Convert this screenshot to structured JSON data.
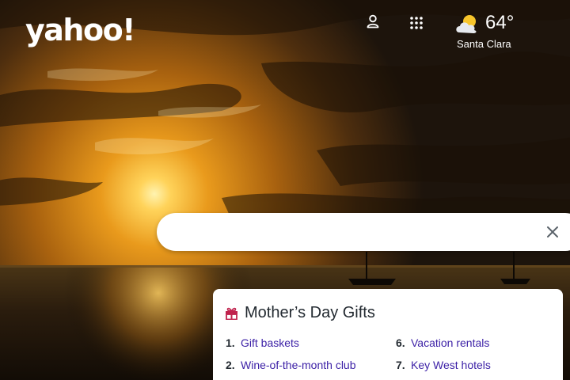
{
  "header": {
    "logo": "yahoo!",
    "account_icon": "user-icon",
    "apps_icon": "grid-icon"
  },
  "weather": {
    "icon": "partly-cloudy-icon",
    "temperature": "64°",
    "location": "Santa Clara"
  },
  "search": {
    "value": "",
    "placeholder": "",
    "clear_icon": "close-icon"
  },
  "trending": {
    "icon": "gift-icon",
    "title": "Mother’s Day Gifts",
    "items": [
      {
        "num": "1.",
        "label": "Gift baskets"
      },
      {
        "num": "2.",
        "label": "Wine-of-the-month club"
      },
      {
        "num": "6.",
        "label": "Vacation rentals"
      },
      {
        "num": "7.",
        "label": "Key West hotels"
      }
    ]
  },
  "colors": {
    "link": "#3b1fa6",
    "text": "#232a31",
    "accent_gift": "#c0224d"
  }
}
